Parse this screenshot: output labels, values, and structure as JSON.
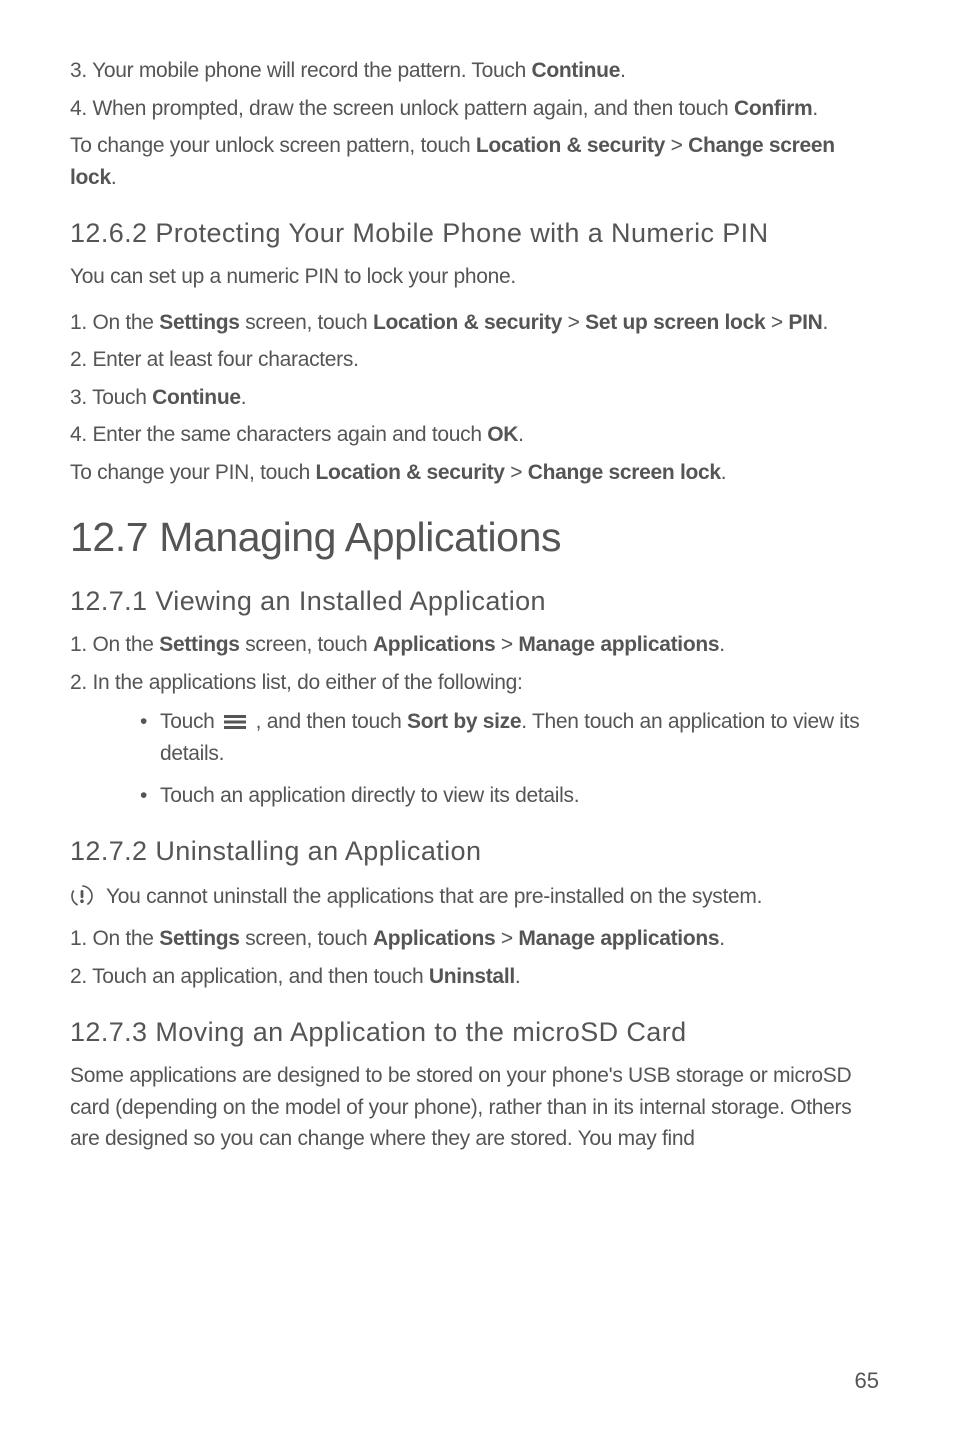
{
  "step_3": {
    "prefix": "3. Your mobile phone will record the pattern. Touch ",
    "bold1": "Continue",
    "suffix1": "."
  },
  "step_4a": {
    "prefix": "4. When prompted, draw the screen unlock pattern again, and then touch ",
    "bold1": "Confirm",
    "suffix1": "."
  },
  "para_change_pattern": {
    "prefix": "To change your unlock screen pattern, touch ",
    "bold1": "Location & security",
    "mid1": " > ",
    "bold2": "Change screen lock",
    "suffix": "."
  },
  "sec_12_6_2": {
    "num": "12.6.2 ",
    "title": "Protecting Your Mobile Phone with a Numeric PIN",
    "intro": "You can set up a numeric PIN to lock your phone.",
    "step1": {
      "prefix": "1. On the ",
      "bold1": "Settings",
      "mid1": " screen, touch ",
      "bold2": "Location & security",
      "mid2": " > ",
      "bold3": "Set up screen lock",
      "mid3": " > ",
      "bold4": "PIN",
      "suffix": "."
    },
    "step2": "2. Enter at least four characters.",
    "step3": {
      "prefix": "3. Touch ",
      "bold1": "Continue",
      "suffix": "."
    },
    "step4": {
      "prefix": "4. Enter the same characters again and touch ",
      "bold1": "OK",
      "suffix": "."
    },
    "change_pin": {
      "prefix": "To change your PIN, touch ",
      "bold1": "Location & security",
      "mid1": " > ",
      "bold2": "Change screen lock",
      "suffix": "."
    }
  },
  "sec_12_7": {
    "num": "12.7 ",
    "title": "Managing Applications"
  },
  "sec_12_7_1": {
    "num": "12.7.1 ",
    "title": "Viewing an Installed Application",
    "step1": {
      "prefix": "1. On the ",
      "bold1": "Settings",
      "mid1": " screen, touch ",
      "bold2": "Applications",
      "mid2": " > ",
      "bold3": "Manage applications",
      "suffix": "."
    },
    "step2": "2. In the applications list, do either of the following:",
    "bullet1": {
      "prefix": "Touch ",
      "mid1": " , and then touch ",
      "bold1": "Sort by size",
      "suffix": ". Then touch an application to view its details."
    },
    "bullet2": "Touch an application directly to view its details."
  },
  "sec_12_7_2": {
    "num": "12.7.2 ",
    "title": "Uninstalling an Application",
    "note": "You cannot uninstall the applications that are pre-installed on the system.",
    "step1": {
      "prefix": "1. On the ",
      "bold1": "Settings",
      "mid1": " screen, touch ",
      "bold2": "Applications",
      "mid2": " > ",
      "bold3": "Manage applications",
      "suffix": "."
    },
    "step2": {
      "prefix": "2. Touch an application, and then touch ",
      "bold1": "Uninstall",
      "suffix": "."
    }
  },
  "sec_12_7_3": {
    "num": "12.7.3 ",
    "title": "Moving an Application to the microSD Card",
    "para": "Some applications are designed to be stored on your phone's USB storage or microSD card (depending on the model of your phone), rather than in its internal storage. Others are designed so you can change where they are stored. You may find"
  },
  "page_number": "65"
}
